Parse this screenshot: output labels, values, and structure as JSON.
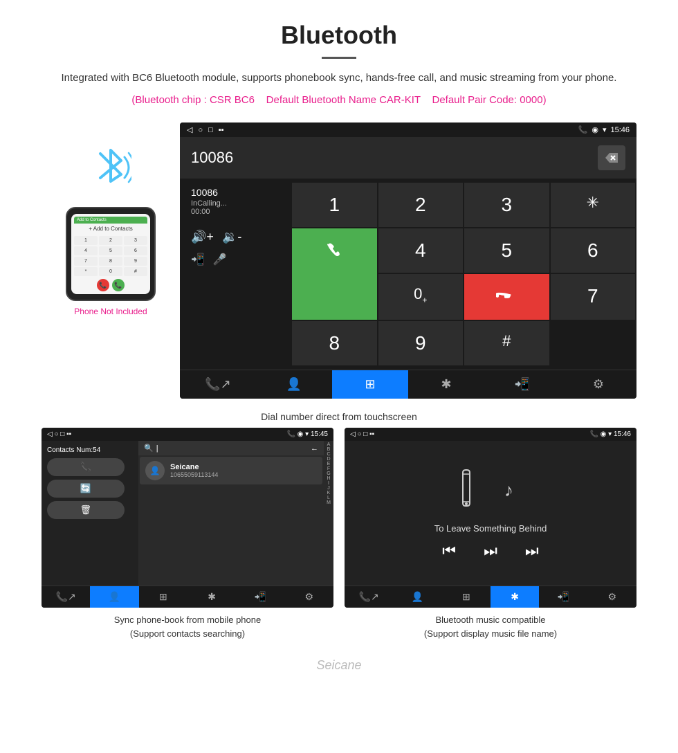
{
  "header": {
    "title": "Bluetooth",
    "description": "Integrated with BC6 Bluetooth module, supports phonebook sync, hands-free call, and music streaming from your phone.",
    "chip_info": "(Bluetooth chip : CSR BC6",
    "default_name": "Default Bluetooth Name CAR-KIT",
    "default_pair": "Default Pair Code: 0000)",
    "phone_not_included": "Phone Not Included"
  },
  "dial_screen": {
    "status_time": "15:46",
    "dial_number": "10086",
    "incalling_label": "InCalling...",
    "timer": "00:00",
    "keys": [
      "1",
      "2",
      "3",
      "*",
      "4",
      "5",
      "6",
      "0+",
      "7",
      "8",
      "9",
      "#"
    ],
    "caption": "Dial number direct from touchscreen"
  },
  "contacts_screen": {
    "status_time": "15:45",
    "contacts_num_label": "Contacts Num:",
    "contacts_num_value": "54",
    "search_placeholder": "",
    "contact_name": "Seicane",
    "contact_number": "10655059113144",
    "alphabet": [
      "A",
      "B",
      "C",
      "D",
      "E",
      "F",
      "G",
      "H",
      "I",
      "J",
      "K",
      "L",
      "M"
    ],
    "caption_line1": "Sync phone-book from mobile phone",
    "caption_line2": "(Support contacts searching)"
  },
  "music_screen": {
    "status_time": "15:46",
    "track_name": "To Leave Something Behind",
    "caption_line1": "Bluetooth music compatible",
    "caption_line2": "(Support display music file name)"
  },
  "watermark": "Seicane"
}
